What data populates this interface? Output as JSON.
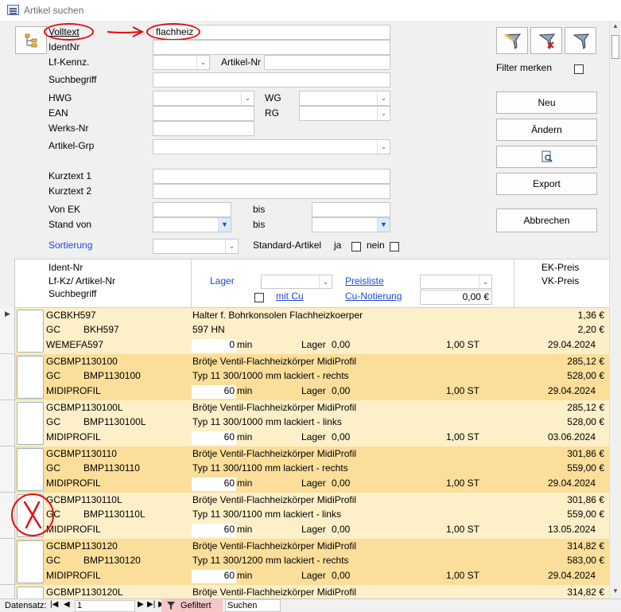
{
  "window": {
    "title": "Artikel suchen"
  },
  "search": {
    "volltext_label": "Volltext",
    "volltext_value": "flachheiz",
    "identnr_label": "IdentNr",
    "lfkennz_label": "Lf-Kennz.",
    "artikelnr_label": "Artikel-Nr",
    "suchbegriff_label": "Suchbegriff",
    "hwg_label": "HWG",
    "wg_label": "WG",
    "ean_label": "EAN",
    "rg_label": "RG",
    "werksnr_label": "Werks-Nr",
    "artikelgrp_label": "Artikel-Grp",
    "kurztext1_label": "Kurztext 1",
    "kurztext2_label": "Kurztext 2",
    "vonek_label": "Von EK",
    "bis1_label": "bis",
    "standvon_label": "Stand von",
    "bis2_label": "bis",
    "sortierung_label": "Sortierung",
    "standard_artikel_label": "Standard-Artikel",
    "ja_label": "ja",
    "nein_label": "nein"
  },
  "right_panel": {
    "filter_merken_label": "Filter merken",
    "neu": "Neu",
    "aendern": "Ändern",
    "export": "Export",
    "abbrechen": "Abbrechen"
  },
  "grid_header": {
    "line1": "Ident-Nr",
    "line2": "Lf-Kz/ Artikel-Nr",
    "line3": "Suchbegriff",
    "lager": "Lager",
    "mit_cu": "mit Cu",
    "preisliste": "Preisliste",
    "cu_notierung": "Cu-Notierung",
    "cu_value": "0,00 €",
    "ek_preis": "EK-Preis",
    "vk_preis": "VK-Preis"
  },
  "rows": [
    {
      "ident": "GCBKH597",
      "lf": "GC",
      "artnr": "BKH597",
      "such": "WEMEFA597",
      "desc1": "Halter f. Bohrkonsolen Flachheizkoerper",
      "desc2": "597 HN",
      "min_val": "0",
      "min": "min",
      "lager": "Lager",
      "lager_val": "0,00",
      "qty": "1,00 ST",
      "ek": "1,36 €",
      "vk": "2,20 €",
      "date": "29.04.2024"
    },
    {
      "ident": "GCBMP1130100",
      "lf": "GC",
      "artnr": "BMP1130100",
      "such": "MIDIPROFIL",
      "desc1": "Brötje Ventil-Flachheizkörper MidiProfil",
      "desc2": "Typ 11 300/1000 mm lackiert - rechts",
      "min_val": "60",
      "min": "min",
      "lager": "Lager",
      "lager_val": "0,00",
      "qty": "1,00 ST",
      "ek": "285,12 €",
      "vk": "528,00 €",
      "date": "29.04.2024"
    },
    {
      "ident": "GCBMP1130100L",
      "lf": "GC",
      "artnr": "BMP1130100L",
      "such": "MIDIPROFIL",
      "desc1": "Brötje Ventil-Flachheizkörper MidiProfil",
      "desc2": "Typ 11 300/1000 mm lackiert - links",
      "min_val": "60",
      "min": "min",
      "lager": "Lager",
      "lager_val": "0,00",
      "qty": "1,00 ST",
      "ek": "285,12 €",
      "vk": "528,00 €",
      "date": "03.06.2024"
    },
    {
      "ident": "GCBMP1130110",
      "lf": "GC",
      "artnr": "BMP1130110",
      "such": "MIDIPROFIL",
      "desc1": "Brötje Ventil-Flachheizkörper MidiProfil",
      "desc2": "Typ 11 300/1100 mm lackiert - rechts",
      "min_val": "60",
      "min": "min",
      "lager": "Lager",
      "lager_val": "0,00",
      "qty": "1,00 ST",
      "ek": "301,86 €",
      "vk": "559,00 €",
      "date": "29.04.2024"
    },
    {
      "ident": "GCBMP1130110L",
      "lf": "GC",
      "artnr": "BMP1130110L",
      "such": "MIDIPROFIL",
      "desc1": "Brötje Ventil-Flachheizkörper MidiProfil",
      "desc2": "Typ 11 300/1100 mm lackiert - links",
      "min_val": "60",
      "min": "min",
      "lager": "Lager",
      "lager_val": "0,00",
      "qty": "1,00 ST",
      "ek": "301,86 €",
      "vk": "559,00 €",
      "date": "13.05.2024"
    },
    {
      "ident": "GCBMP1130120",
      "lf": "GC",
      "artnr": "BMP1130120",
      "such": "MIDIPROFIL",
      "desc1": "Brötje Ventil-Flachheizkörper MidiProfil",
      "desc2": "Typ 11 300/1200 mm lackiert - rechts",
      "min_val": "60",
      "min": "min",
      "lager": "Lager",
      "lager_val": "0,00",
      "qty": "1,00 ST",
      "ek": "314,82 €",
      "vk": "583,00 €",
      "date": "29.04.2024"
    },
    {
      "ident": "GCBMP1130120L",
      "lf": "",
      "artnr": "",
      "such": "",
      "desc1": "Brötje Ventil-Flachheizkörper MidiProfil",
      "desc2": "",
      "min_val": "",
      "min": "",
      "lager": "",
      "lager_val": "",
      "qty": "",
      "ek": "314,82 €",
      "vk": "",
      "date": ""
    }
  ],
  "row_colors": [
    "#fdefc8",
    "#fbde9a"
  ],
  "status": {
    "datensatz_label": "Datensatz:",
    "record": "1",
    "gefiltert": "Gefiltert",
    "suchen": "Suchen"
  },
  "annotation_color": "#e01010"
}
